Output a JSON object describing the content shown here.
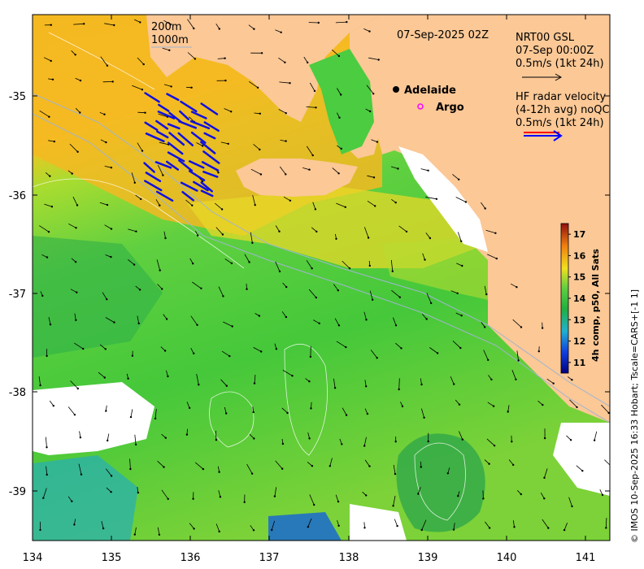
{
  "map": {
    "title": "07-Sep-2025 02Z",
    "credit": "© IMOS 10-Sep-2025 16:33 Hobart; Tscale=CARS+[-1 1]",
    "x_ticks": [
      "134",
      "135",
      "136",
      "137",
      "138",
      "139",
      "140",
      "141"
    ],
    "y_ticks": [
      "-35",
      "-36",
      "-37",
      "-38",
      "-39"
    ],
    "x_range": [
      134,
      141.3
    ],
    "y_range": [
      -39.5,
      -33.8
    ],
    "isobath_labels": [
      "200m",
      "1000m"
    ],
    "places": [
      {
        "name": "Adelaide",
        "lon": 138.6,
        "lat": -34.93
      },
      {
        "name": "Argo",
        "lon": 138.8,
        "lat": -35.12
      }
    ],
    "legend": {
      "model_lines": [
        "NRT00 GSL",
        "07-Sep 00:00Z",
        "0.5m/s (1kt 24h)"
      ],
      "radar_lines": [
        "HF radar velocity",
        "(4-12h avg) noQC",
        "0.5m/s (1kt 24h)"
      ]
    },
    "colorbar": {
      "label": "4h comp, p50, All Sats",
      "ticks": [
        "11",
        "12",
        "13",
        "14",
        "15",
        "16",
        "17"
      ],
      "range": [
        10.5,
        17.5
      ]
    },
    "colors": {
      "land": "#fbc896",
      "warm": "#f5b520",
      "mid": "#55d040",
      "cool": "#22a040",
      "nodata": "#ffffff"
    }
  }
}
